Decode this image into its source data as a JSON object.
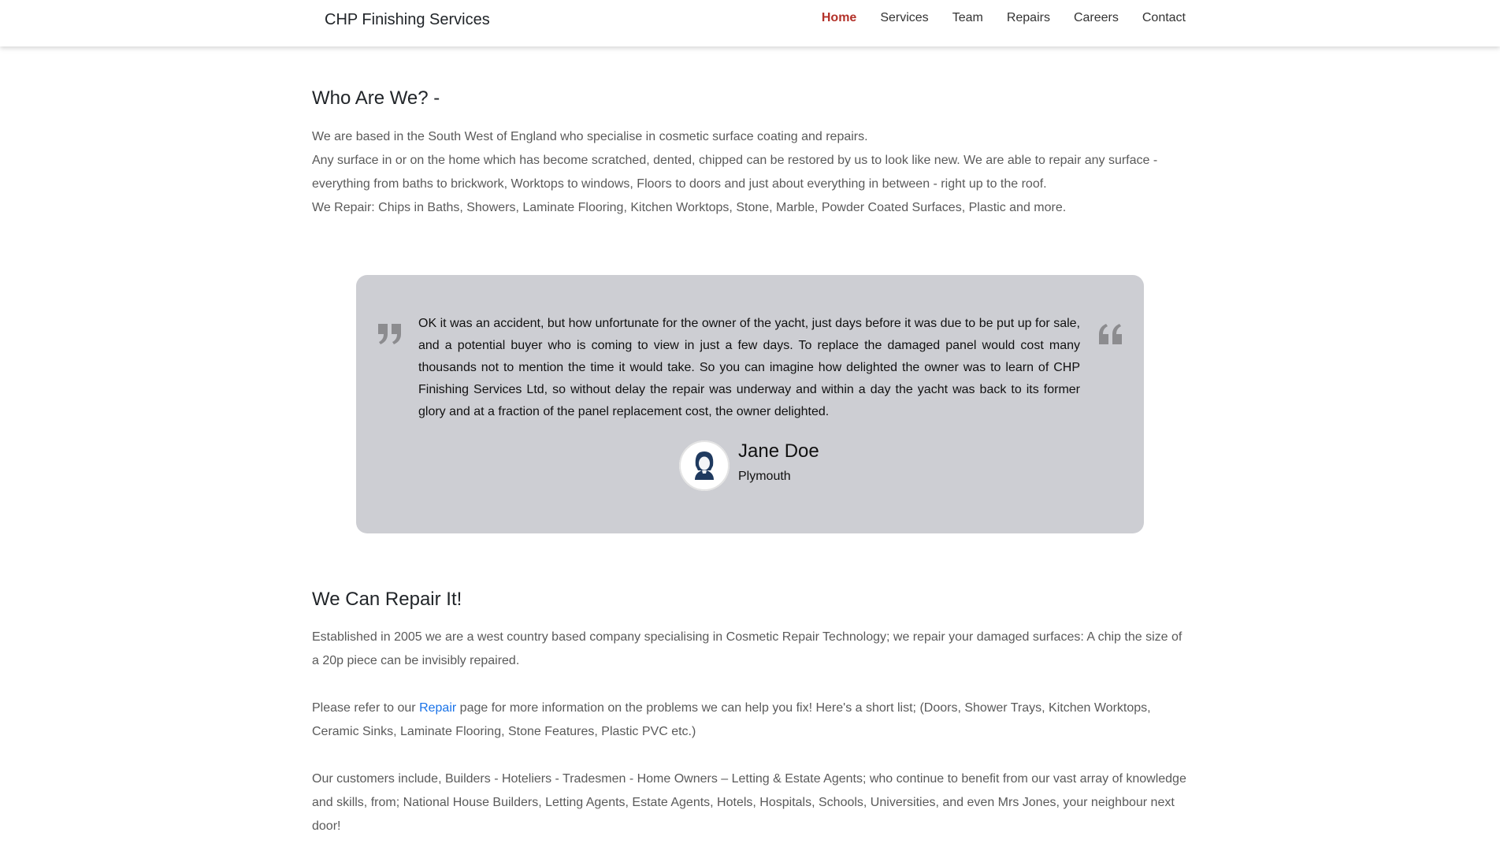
{
  "navbar": {
    "brand": "CHP Finishing Services",
    "links": [
      {
        "label": "Home",
        "active": true
      },
      {
        "label": "Services",
        "active": false
      },
      {
        "label": "Team",
        "active": false
      },
      {
        "label": "Repairs",
        "active": false
      },
      {
        "label": "Careers",
        "active": false
      },
      {
        "label": "Contact",
        "active": false
      }
    ]
  },
  "who": {
    "title": "Who Are We? -",
    "line1": "We are based in the South West of England who specialise in cosmetic surface coating and repairs.",
    "line2": "Any surface in or on the home which has become scratched, dented, chipped can be restored by us to look like new. We are able to repair any surface - everything from baths to brickwork, Worktops to windows, Floors to doors and just about everything in between - right up to the roof.",
    "line3": "We Repair: Chips in Baths, Showers, Laminate Flooring, Kitchen Worktops, Stone, Marble, Powder Coated Surfaces, Plastic and more."
  },
  "testimonial": {
    "text": "OK it was an accident, but how unfortunate for the owner of the yacht, just days before it was due to be put up for sale, and a potential buyer who is coming to view in just a few days. To replace the damaged panel would cost many thousands not to mention the time it would take. So you can imagine how delighted the owner was to learn of CHP Finishing Services Ltd, so without delay the repair was underway and within a day the yacht was back to its former glory and at a fraction of the panel replacement cost, the owner delighted.",
    "author_name": "Jane Doe",
    "author_city": "Plymouth",
    "left_icon": "quote-close-icon",
    "right_icon": "quote-open-icon",
    "avatar_icon": "woman-avatar-icon"
  },
  "repair": {
    "title": "We Can Repair It!",
    "p1": "Established in 2005 we are a west country based company specialising in Cosmetic Repair Technology; we repair your damaged surfaces: A chip the size of a 20p piece can be invisibly repaired.",
    "p2_before": "Please refer to our ",
    "p2_link": "Repair",
    "p2_after": " page for more information on the problems we can help you fix! Here's a short list; (Doors, Shower Trays, Kitchen Worktops, Ceramic Sinks, Laminate Flooring, Stone Features, Plastic PVC etc.)",
    "p3": "Our customers include, Builders - Hoteliers - Tradesmen - Home Owners – Letting & Estate Agents; who continue to benefit from our vast array of knowledge and skills, from; National House Builders, Letting Agents, Estate Agents, Hotels, Hospitals, Schools, Universities, and even Mrs Jones, your neighbour next door!"
  },
  "colors": {
    "active_nav": "#b3322a",
    "testimonial_bg": "#cdced3",
    "link": "#1a73e8",
    "quote_icon": "#8c8c8f"
  }
}
